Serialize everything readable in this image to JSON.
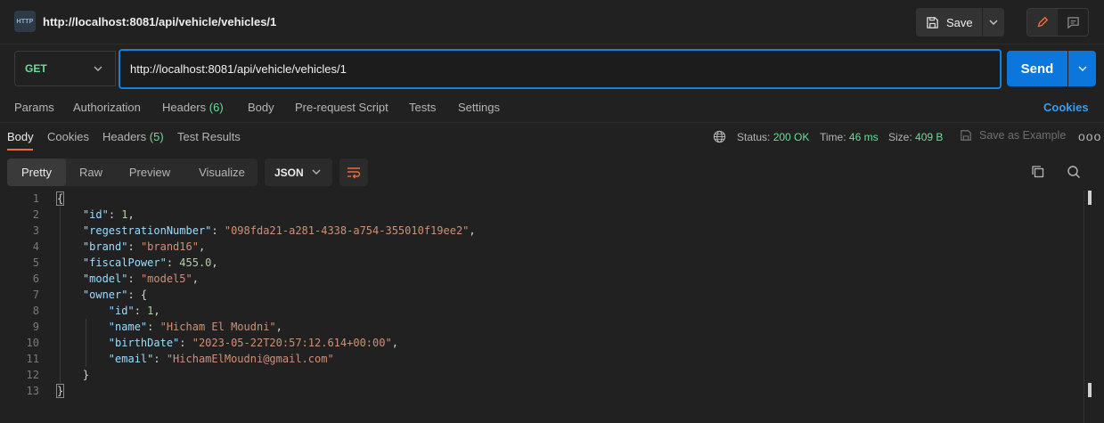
{
  "tab": {
    "title": "http://localhost:8081/api/vehicle/vehicles/1",
    "badge": "HTTP"
  },
  "toolbar": {
    "save_label": "Save"
  },
  "request": {
    "method": "GET",
    "url": "http://localhost:8081/api/vehicle/vehicles/1",
    "send_label": "Send",
    "tabs": [
      {
        "label": "Params"
      },
      {
        "label": "Authorization"
      },
      {
        "label": "Headers",
        "count": "(6)"
      },
      {
        "label": "Body"
      },
      {
        "label": "Pre-request Script"
      },
      {
        "label": "Tests"
      },
      {
        "label": "Settings"
      }
    ],
    "cookies_label": "Cookies"
  },
  "response": {
    "tabs": [
      {
        "label": "Body"
      },
      {
        "label": "Cookies"
      },
      {
        "label": "Headers",
        "count": "(5)"
      },
      {
        "label": "Test Results"
      }
    ],
    "status_label": "Status:",
    "status_value": "200 OK",
    "time_label": "Time:",
    "time_value": "46 ms",
    "size_label": "Size:",
    "size_value": "409 B",
    "save_example_label": "Save as Example",
    "more": "ooo",
    "format_buttons": [
      "Pretty",
      "Raw",
      "Preview",
      "Visualize"
    ],
    "language": "JSON"
  },
  "body_lines": [
    {
      "n": "1"
    },
    {
      "n": "2",
      "key": "\"id\"",
      "num": "1"
    },
    {
      "n": "3",
      "key": "\"regestrationNumber\"",
      "str": "\"098fda21-a281-4338-a754-355010f19ee2\""
    },
    {
      "n": "4",
      "key": "\"brand\"",
      "str": "\"brand16\""
    },
    {
      "n": "5",
      "key": "\"fiscalPower\"",
      "num": "455.0"
    },
    {
      "n": "6",
      "key": "\"model\"",
      "str": "\"model5\""
    },
    {
      "n": "7",
      "key": "\"owner\""
    },
    {
      "n": "8",
      "key": "\"id\"",
      "num": "1"
    },
    {
      "n": "9",
      "key": "\"name\"",
      "str": "\"Hicham El Moudni\""
    },
    {
      "n": "10",
      "key": "\"birthDate\"",
      "str": "\"2023-05-22T20:57:12.614+00:00\""
    },
    {
      "n": "11",
      "key": "\"email\"",
      "str": "\"HichamElMoudni@gmail.com\""
    },
    {
      "n": "12"
    },
    {
      "n": "13"
    }
  ],
  "colors": {
    "accent": "#0b76db",
    "status_ok": "#6bdd9a",
    "active_tab_underline": "#f26b3a",
    "json_key": "#9cdcfe",
    "json_string": "#ce9178"
  }
}
